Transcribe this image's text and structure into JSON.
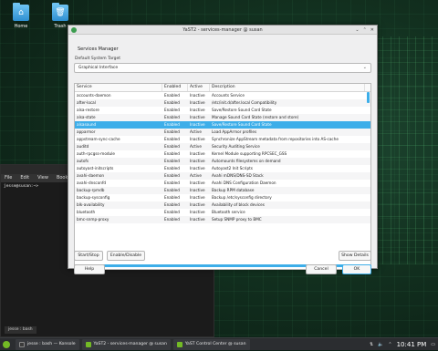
{
  "desktop": {
    "icons": [
      {
        "label": "Home",
        "icon": "folder-home-icon"
      },
      {
        "label": "Trash",
        "icon": "trash-icon"
      }
    ]
  },
  "terminal": {
    "menu": [
      "File",
      "Edit",
      "View",
      "Bookm"
    ],
    "prompt": "jesse@susan:~>",
    "tab_label": "jesse : bash"
  },
  "dialog": {
    "title": "YaST2 - services-manager @ susan",
    "heading": "Services Manager",
    "default_target_label": "Default System Target",
    "default_target_value": "Graphical Interface",
    "columns": [
      "Service",
      "Enabled",
      "Active",
      "Description"
    ],
    "rows": [
      {
        "service": "accounts-daemon",
        "enabled": "Enabled",
        "active": "Inactive",
        "description": "Accounts Service"
      },
      {
        "service": "after-local",
        "enabled": "Enabled",
        "active": "Inactive",
        "description": "/etc/init.d/after.local Compatibility"
      },
      {
        "service": "alsa-restore",
        "enabled": "Enabled",
        "active": "Inactive",
        "description": "Save/Restore Sound Card State"
      },
      {
        "service": "alsa-state",
        "enabled": "Enabled",
        "active": "Inactive",
        "description": "Manage Sound Card State (restore and store)"
      },
      {
        "service": "alsasound",
        "enabled": "Enabled",
        "active": "Inactive",
        "description": "Save/Restore Sound Card State",
        "selected": true
      },
      {
        "service": "apparmor",
        "enabled": "Enabled",
        "active": "Active",
        "description": "Load AppArmor profiles"
      },
      {
        "service": "appstream-sync-cache",
        "enabled": "Enabled",
        "active": "Inactive",
        "description": "Synchronize AppStream metadata from repositories into AS-cache"
      },
      {
        "service": "auditd",
        "enabled": "Enabled",
        "active": "Active",
        "description": "Security Auditing Service"
      },
      {
        "service": "auth-rpcgss-module",
        "enabled": "Enabled",
        "active": "Inactive",
        "description": "Kernel Module supporting RPCSEC_GSS"
      },
      {
        "service": "autofs",
        "enabled": "Enabled",
        "active": "Inactive",
        "description": "Automounts filesystems on demand"
      },
      {
        "service": "autoyast-initscripts",
        "enabled": "Enabled",
        "active": "Inactive",
        "description": "Autoyast2 Init Scripts"
      },
      {
        "service": "avahi-daemon",
        "enabled": "Enabled",
        "active": "Active",
        "description": "Avahi mDNS/DNS-SD Stack"
      },
      {
        "service": "avahi-dnsconfd",
        "enabled": "Enabled",
        "active": "Inactive",
        "description": "Avahi DNS Configuration Daemon"
      },
      {
        "service": "backup-rpmdb",
        "enabled": "Enabled",
        "active": "Inactive",
        "description": "Backup RPM database"
      },
      {
        "service": "backup-sysconfig",
        "enabled": "Enabled",
        "active": "Inactive",
        "description": "Backup /etc/sysconfig directory"
      },
      {
        "service": "blk-availability",
        "enabled": "Enabled",
        "active": "Inactive",
        "description": "Availability of block devices"
      },
      {
        "service": "bluetooth",
        "enabled": "Enabled",
        "active": "Inactive",
        "description": "Bluetooth service"
      },
      {
        "service": "bmc-snmp-proxy",
        "enabled": "Enabled",
        "active": "Inactive",
        "description": "Setup SNMP proxy to BMC"
      }
    ],
    "buttons": {
      "start_stop": "Start/Stop",
      "enable_disable": "Enable/Disable",
      "show_details": "Show Details",
      "help": "Help",
      "cancel": "Cancel",
      "ok": "OK"
    }
  },
  "taskbar": {
    "tasks": [
      {
        "label": "jesse : bash — Konsole",
        "color": "#3a3a3a"
      },
      {
        "label": "YaST2 - services-manager @ susan",
        "color": "#73ba25"
      },
      {
        "label": "YaST Control Center @ susan",
        "color": "#73ba25"
      }
    ],
    "clock": "10:41 PM"
  }
}
